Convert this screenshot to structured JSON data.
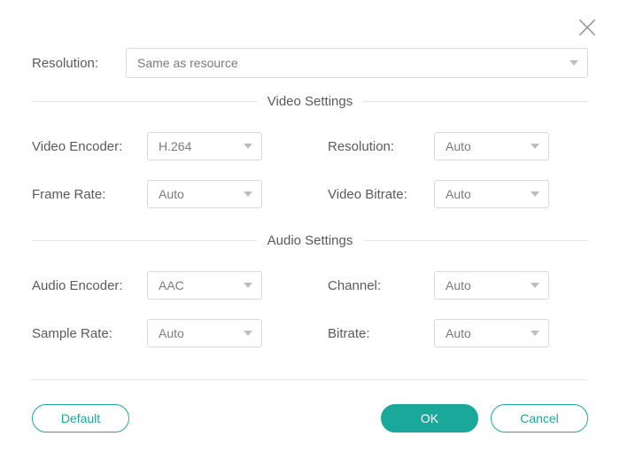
{
  "top": {
    "resolution_label": "Resolution:",
    "resolution_value": "Same as resource"
  },
  "video": {
    "section_title": "Video Settings",
    "encoder_label": "Video Encoder:",
    "encoder_value": "H.264",
    "frame_rate_label": "Frame Rate:",
    "frame_rate_value": "Auto",
    "resolution_label": "Resolution:",
    "resolution_value": "Auto",
    "bitrate_label": "Video Bitrate:",
    "bitrate_value": "Auto"
  },
  "audio": {
    "section_title": "Audio Settings",
    "encoder_label": "Audio Encoder:",
    "encoder_value": "AAC",
    "sample_rate_label": "Sample Rate:",
    "sample_rate_value": "Auto",
    "channel_label": "Channel:",
    "channel_value": "Auto",
    "bitrate_label": "Bitrate:",
    "bitrate_value": "Auto"
  },
  "buttons": {
    "default": "Default",
    "ok": "OK",
    "cancel": "Cancel"
  }
}
